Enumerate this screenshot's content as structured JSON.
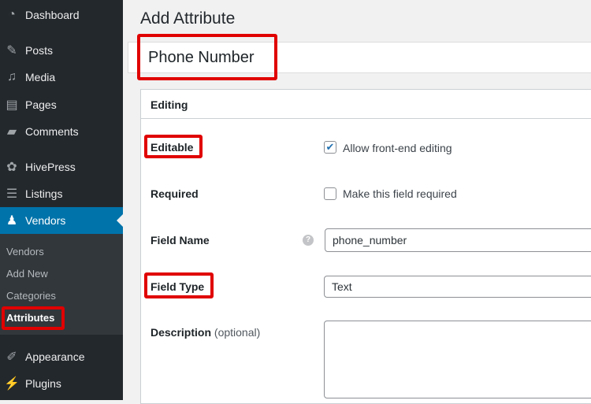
{
  "sidebar": {
    "items": [
      {
        "label": "Dashboard",
        "icon": "dashboard-icon",
        "glyph": "◔"
      },
      {
        "label": "Posts",
        "icon": "pin-icon",
        "glyph": "✎"
      },
      {
        "label": "Media",
        "icon": "media-icon",
        "glyph": "♫"
      },
      {
        "label": "Pages",
        "icon": "pages-icon",
        "glyph": "▤"
      },
      {
        "label": "Comments",
        "icon": "comment-icon",
        "glyph": "▰"
      },
      {
        "label": "HivePress",
        "icon": "hivepress-icon",
        "glyph": "✿"
      },
      {
        "label": "Listings",
        "icon": "listings-icon",
        "glyph": "☰"
      },
      {
        "label": "Vendors",
        "icon": "user-icon",
        "glyph": "♟"
      },
      {
        "label": "Appearance",
        "icon": "brush-icon",
        "glyph": "✐"
      },
      {
        "label": "Plugins",
        "icon": "plug-icon",
        "glyph": "⚡"
      }
    ],
    "submenu": [
      "Vendors",
      "Add New",
      "Categories",
      "Attributes"
    ]
  },
  "page": {
    "title": "Add Attribute",
    "name_value": "Phone Number"
  },
  "panel": {
    "heading": "Editing",
    "editable_label": "Editable",
    "editable_text": "Allow front-end editing",
    "editable_checked": true,
    "required_label": "Required",
    "required_text": "Make this field required",
    "required_checked": false,
    "field_name_label": "Field Name",
    "field_name_value": "phone_number",
    "help_glyph": "?",
    "field_type_label": "Field Type",
    "field_type_value": "Text",
    "description_label": "Description",
    "description_optional": "(optional)"
  },
  "colors": {
    "sidebar": "#23282d",
    "active": "#0073aa",
    "highlight": "#e00000"
  }
}
